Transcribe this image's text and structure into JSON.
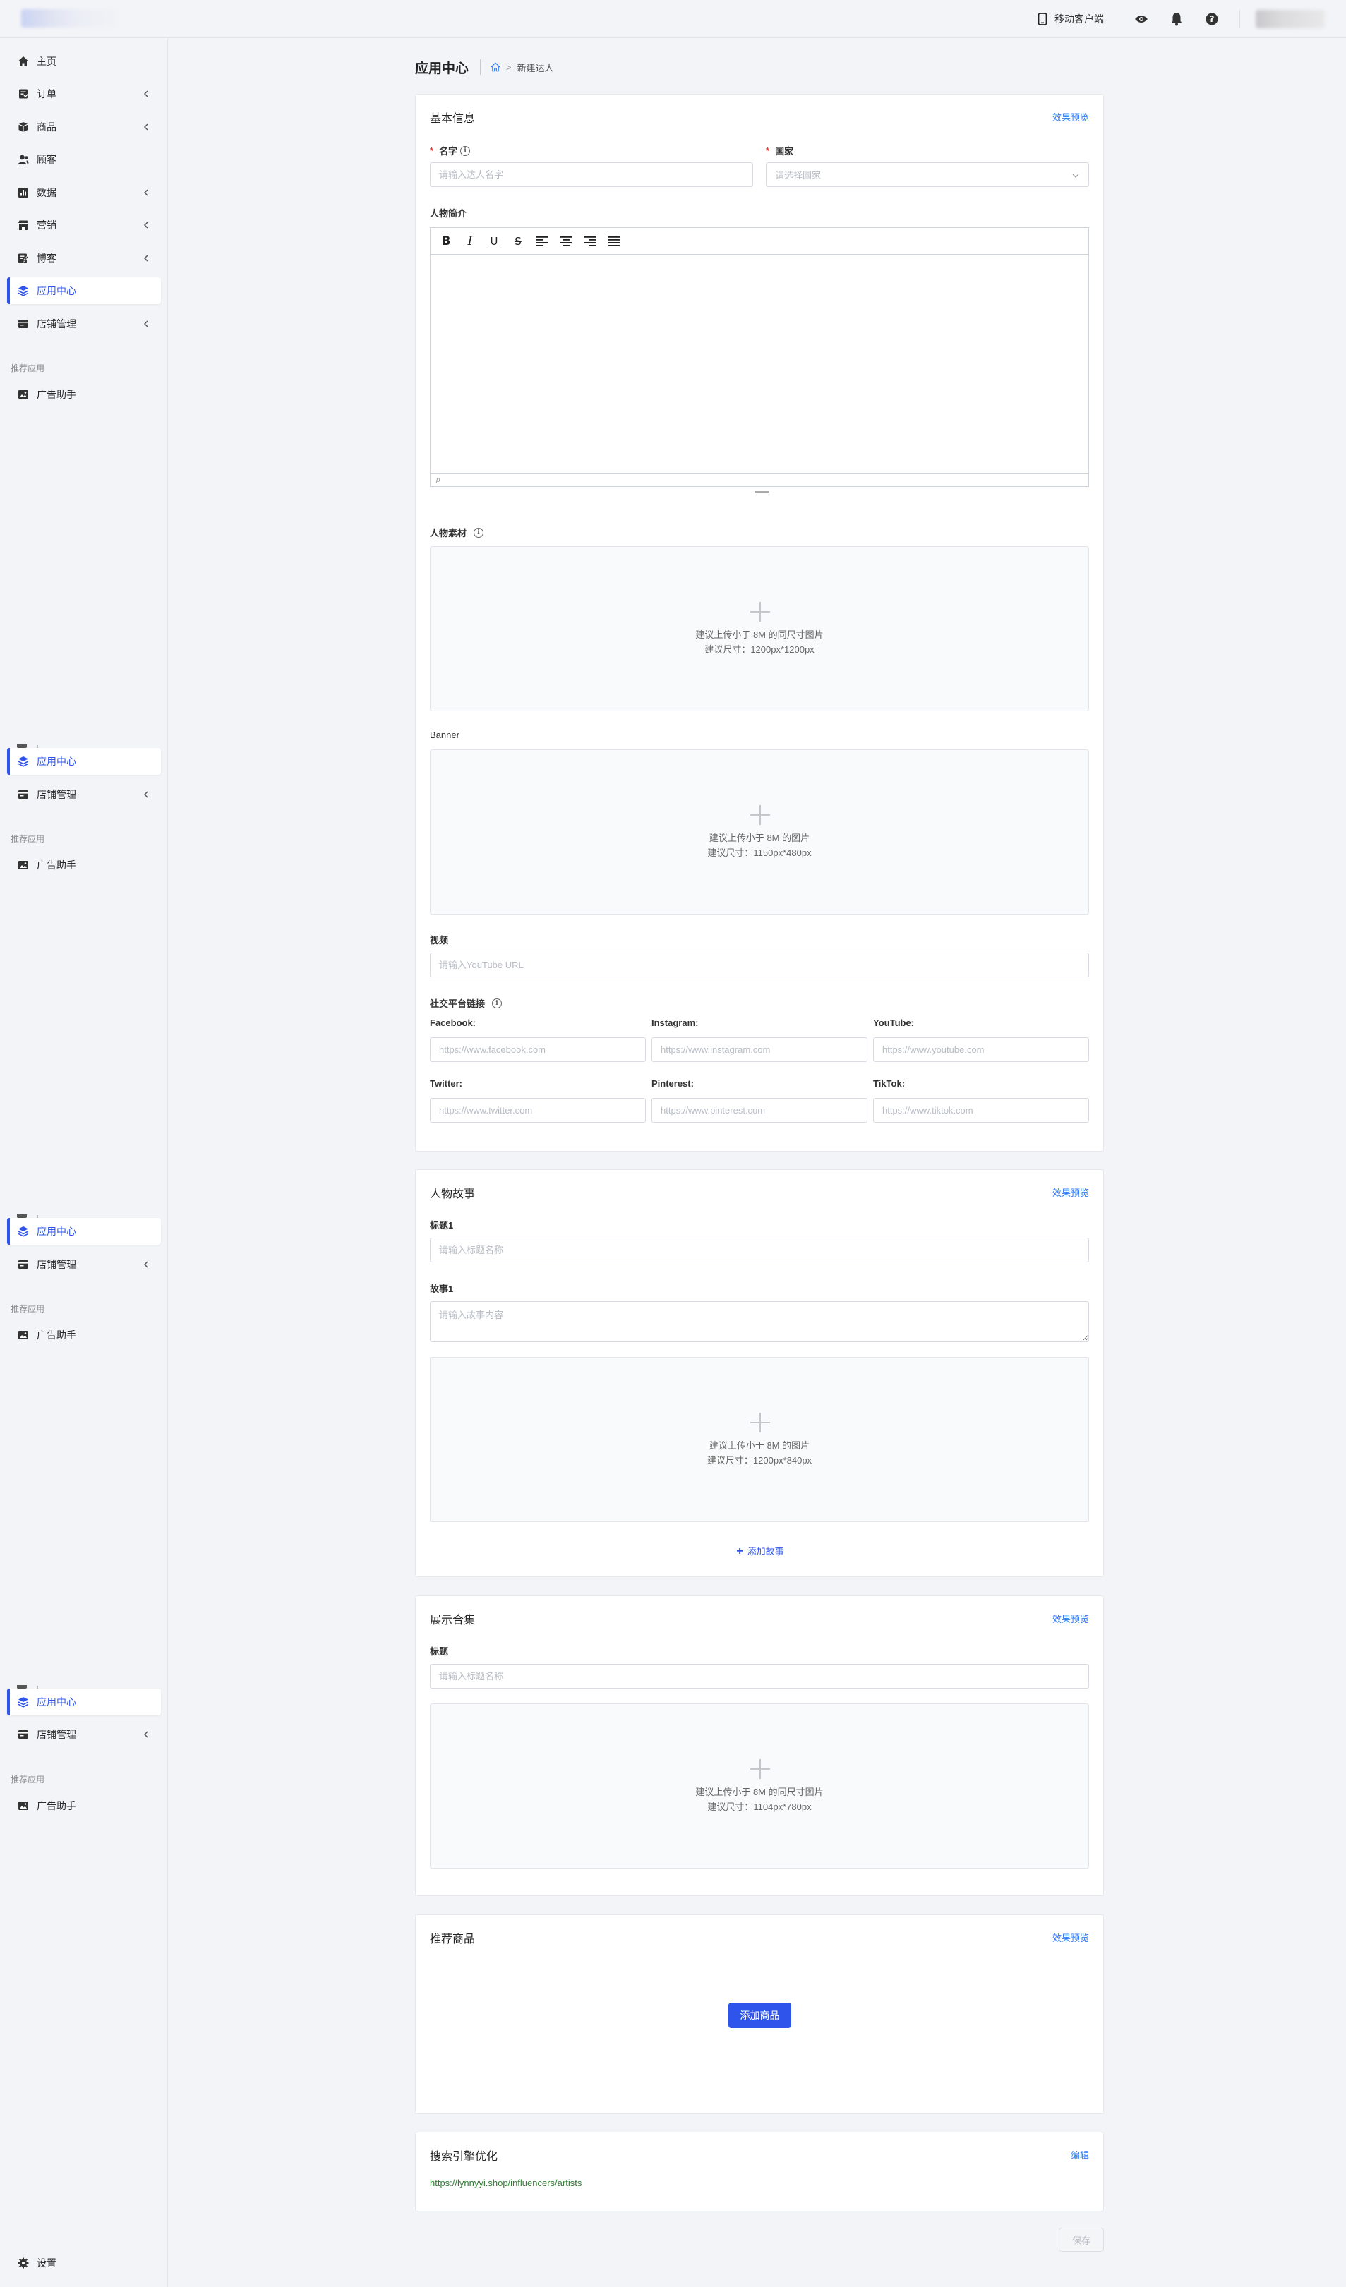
{
  "header": {
    "mobile_label": "移动客户端"
  },
  "sidebar": {
    "items": [
      {
        "label": "主页",
        "icon": "home-icon"
      },
      {
        "label": "订单",
        "icon": "order-icon"
      },
      {
        "label": "商品",
        "icon": "product-icon"
      },
      {
        "label": "顾客",
        "icon": "customer-icon"
      },
      {
        "label": "数据",
        "icon": "chart-icon"
      },
      {
        "label": "营销",
        "icon": "marketing-icon"
      },
      {
        "label": "博客",
        "icon": "blog-icon"
      },
      {
        "label": "应用中心",
        "icon": "layers-icon",
        "active": true
      },
      {
        "label": "店铺管理",
        "icon": "store-icon"
      }
    ],
    "recommended_title": "推荐应用",
    "recommended_app": "广告助手",
    "settings_label": "设置"
  },
  "page": {
    "title": "应用中心",
    "breadcrumb_current": "新建达人"
  },
  "basic": {
    "title": "基本信息",
    "preview": "效果预览",
    "name_label": "名字",
    "name_placeholder": "请输入达人名字",
    "country_label": "国家",
    "country_placeholder": "请选择国家",
    "bio_label": "人物简介",
    "editor_status": "p",
    "material_label": "人物素材",
    "material_line1": "建议上传小于 8M 的同尺寸图片",
    "material_line2": "建议尺寸：1200px*1200px",
    "banner_label": "Banner",
    "banner_line1": "建议上传小于 8M 的图片",
    "banner_line2": "建议尺寸：1150px*480px",
    "video_label": "视频",
    "video_placeholder": "请输入YouTube URL",
    "social_label": "社交平台链接",
    "social": [
      {
        "label": "Facebook:",
        "placeholder": "https://www.facebook.com"
      },
      {
        "label": "Instagram:",
        "placeholder": "https://www.instagram.com"
      },
      {
        "label": "YouTube:",
        "placeholder": "https://www.youtube.com"
      },
      {
        "label": "Twitter:",
        "placeholder": "https://www.twitter.com"
      },
      {
        "label": "Pinterest:",
        "placeholder": "https://www.pinterest.com"
      },
      {
        "label": "TikTok:",
        "placeholder": "https://www.tiktok.com"
      }
    ]
  },
  "story": {
    "title": "人物故事",
    "preview": "效果预览",
    "heading_label": "标题1",
    "heading_placeholder": "请输入标题名称",
    "story_label": "故事1",
    "story_placeholder": "请输入故事内容",
    "upload_line1": "建议上传小于 8M 的图片",
    "upload_line2": "建议尺寸：1200px*840px",
    "add_label": "添加故事"
  },
  "showcase": {
    "title": "展示合集",
    "preview": "效果预览",
    "heading_label": "标题",
    "heading_placeholder": "请输入标题名称",
    "upload_line1": "建议上传小于 8M 的同尺寸图片",
    "upload_line2": "建议尺寸：1104px*780px"
  },
  "products": {
    "title": "推荐商品",
    "preview": "效果预览",
    "add_button": "添加商品"
  },
  "seo": {
    "title": "搜索引擎优化",
    "edit": "编辑",
    "url": "https://lynnyyi.shop/influencers/artists"
  },
  "save_label": "保存"
}
